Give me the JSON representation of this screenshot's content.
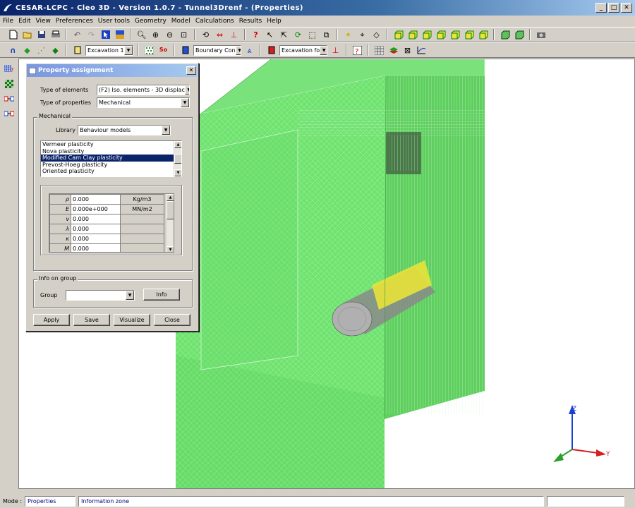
{
  "window": {
    "title": "CESAR-LCPC - Cleo 3D - Version 1.0.7 - Tunnel3Drenf - (Properties)",
    "min": "_",
    "max": "□",
    "close": "✕"
  },
  "menu": [
    "File",
    "Edit",
    "View",
    "Preferences",
    "User tools",
    "Geometry",
    "Model",
    "Calculations",
    "Results",
    "Help"
  ],
  "toolbar2": {
    "excavation_select": "Excavation 1",
    "bc_select": "Boundary Con",
    "excav_for_select": "Excavation fo",
    "so_label": "So"
  },
  "dialog": {
    "title": "Property assignment",
    "close": "✕",
    "type_of_elements_label": "Type of elements",
    "type_of_elements_value": "(F2) Iso. elements - 3D displac",
    "type_of_properties_label": "Type of properties",
    "type_of_properties_value": "Mechanical",
    "mechanical_group": "Mechanical",
    "library_label": "Library",
    "library_value": "Behaviour models",
    "models": [
      "Vermeer plasticity",
      "Nova plasticity",
      "Modified Cam Clay plasticity",
      "Prevost-Hoeg plasticity",
      "Oriented plasticity"
    ],
    "selected_model_index": 2,
    "params": [
      {
        "sym": "ρ",
        "val": "0.000",
        "unit": "Kg/m3"
      },
      {
        "sym": "E",
        "val": "0.000e+000",
        "unit": "MN/m2"
      },
      {
        "sym": "ν",
        "val": "0.000",
        "unit": ""
      },
      {
        "sym": "λ",
        "val": "0.000",
        "unit": ""
      },
      {
        "sym": "κ",
        "val": "0.000",
        "unit": ""
      },
      {
        "sym": "M",
        "val": "0.000",
        "unit": ""
      }
    ],
    "info_group_label": "Info on group",
    "group_label": "Group",
    "group_value": "",
    "info_button": "Info",
    "apply": "Apply",
    "save": "Save",
    "visualize": "Visualize",
    "close_button": "Close"
  },
  "axes": {
    "z": "Z",
    "y": "Y"
  },
  "status": {
    "mode_label": "Mode :",
    "mode_value": "Properties",
    "info": "Information zone"
  },
  "colors": {
    "mesh_green": "#6ee36e",
    "mesh_dark": "#4cb84c",
    "mesh_line": "#d6f5d6",
    "lining_yellow": "#e8e23a",
    "axis_z": "#1a3fd6",
    "axis_y": "#d62020",
    "axis_x": "#2aa02a"
  }
}
